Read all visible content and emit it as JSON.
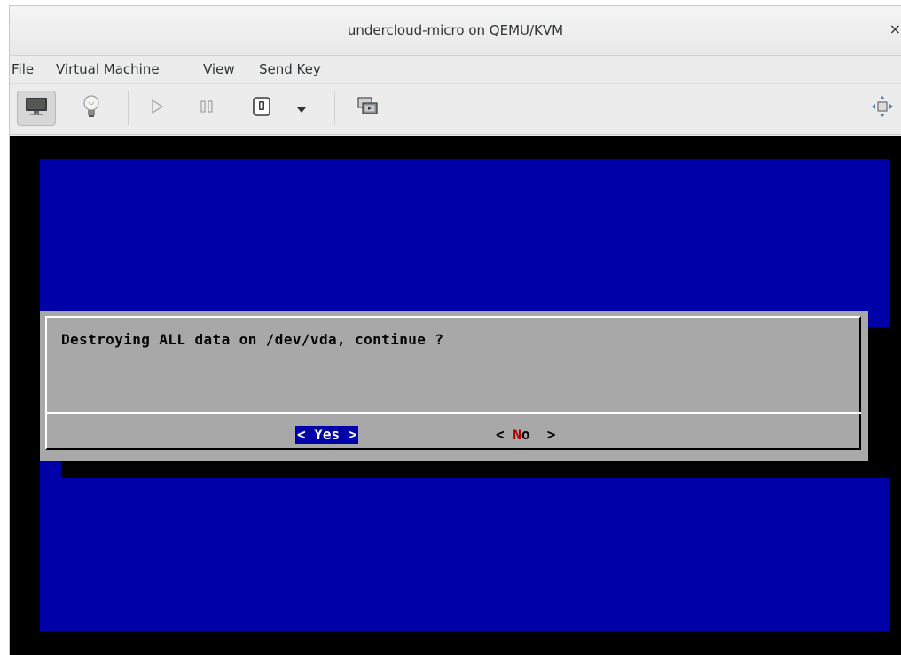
{
  "window": {
    "title": "undercloud-micro on QEMU/KVM",
    "close_glyph": "×"
  },
  "menubar": {
    "items": [
      "File",
      "Virtual Machine",
      "View",
      "Send Key"
    ]
  },
  "toolbar": {
    "buttons": [
      {
        "icon": "monitor-icon",
        "active": true
      },
      {
        "icon": "lightbulb-icon"
      },
      {
        "icon": "play-icon"
      },
      {
        "icon": "pause-icon"
      },
      {
        "icon": "power-icon"
      },
      {
        "icon": "dropdown-arrow-icon"
      },
      {
        "icon": "screenshot-icon"
      },
      {
        "icon": "fullscreen-icon"
      }
    ]
  },
  "dialog": {
    "message": "Destroying ALL data on /dev/vda, continue ?",
    "yes_label": "< Yes >",
    "no_open": "< ",
    "no_hotkey": "N",
    "no_rest": "o  >"
  },
  "colors": {
    "console_blue": "#0000a8",
    "dialog_gray": "#a8a8a8",
    "hotkey_red": "#a80000"
  }
}
